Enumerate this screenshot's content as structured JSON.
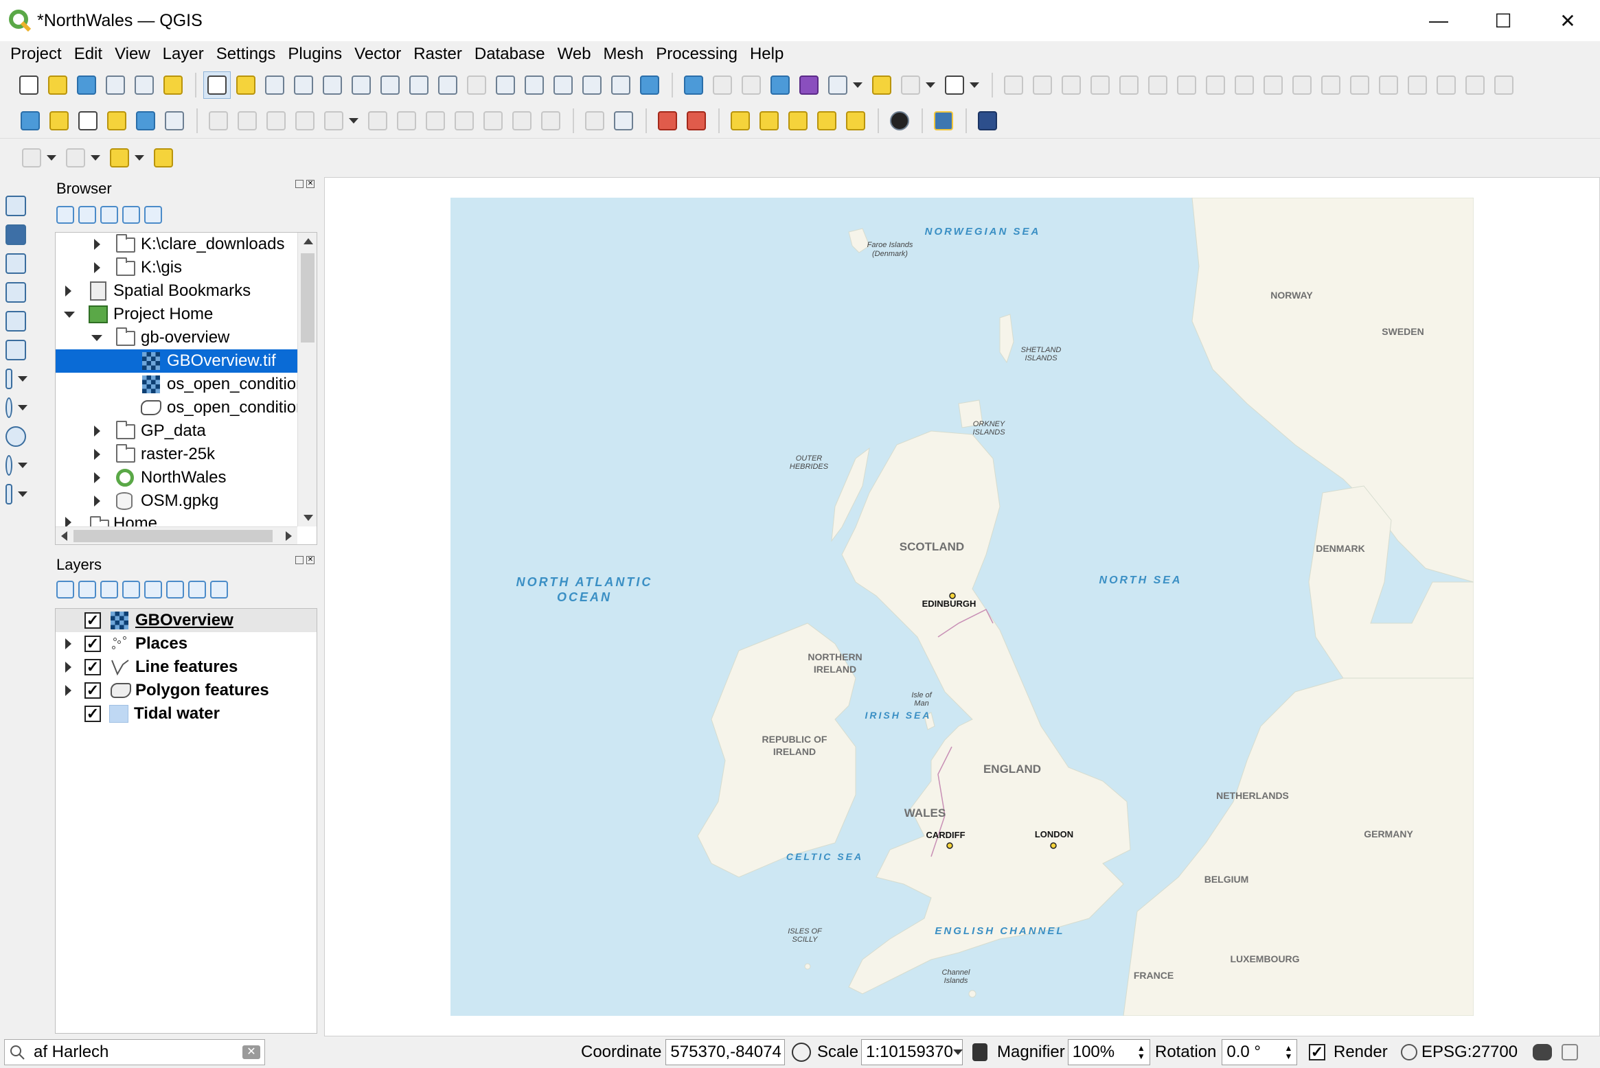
{
  "window": {
    "title": "*NorthWales — QGIS",
    "buttons": {
      "minimize": "—",
      "maximize": "☐",
      "close": "✕"
    }
  },
  "menu": [
    "Project",
    "Edit",
    "View",
    "Layer",
    "Settings",
    "Plugins",
    "Vector",
    "Raster",
    "Database",
    "Web",
    "Mesh",
    "Processing",
    "Help"
  ],
  "browser": {
    "title": "Browser",
    "items": [
      {
        "label": "K:\\clare_downloads",
        "icon": "folder-icon",
        "level": 1,
        "expander": "collapsed"
      },
      {
        "label": "K:\\gis",
        "icon": "folder-icon",
        "level": 1,
        "expander": "collapsed"
      },
      {
        "label": "Spatial Bookmarks",
        "icon": "bookmark-icon",
        "level": 0,
        "expander": "collapsed"
      },
      {
        "label": "Project Home",
        "icon": "project-home-icon",
        "level": 0,
        "expander": "expanded"
      },
      {
        "label": "gb-overview",
        "icon": "folder-icon",
        "level": 1,
        "expander": "expanded"
      },
      {
        "label": "GBOverview.tif",
        "icon": "raster-icon",
        "level": 2,
        "expander": "none",
        "selected": true
      },
      {
        "label": "os_open_condition",
        "icon": "raster-icon",
        "level": 2,
        "expander": "none"
      },
      {
        "label": "os_open_condition",
        "icon": "polygon-icon",
        "level": 2,
        "expander": "none"
      },
      {
        "label": "GP_data",
        "icon": "folder-icon",
        "level": 1,
        "expander": "collapsed"
      },
      {
        "label": "raster-25k",
        "icon": "folder-icon",
        "level": 1,
        "expander": "collapsed"
      },
      {
        "label": "NorthWales",
        "icon": "qgis-project-icon",
        "level": 1,
        "expander": "collapsed"
      },
      {
        "label": "OSM.gpkg",
        "icon": "geopackage-icon",
        "level": 1,
        "expander": "collapsed"
      },
      {
        "label": "Home",
        "icon": "folder-icon",
        "level": 0,
        "expander": "collapsed"
      }
    ]
  },
  "layers": {
    "title": "Layers",
    "items": [
      {
        "label": "GBOverview",
        "icon": "raster-icon",
        "checked": true,
        "expander": "none",
        "underline": true
      },
      {
        "label": "Places",
        "icon": "point-layer-icon",
        "checked": true,
        "expander": "collapsed"
      },
      {
        "label": "Line features",
        "icon": "line-layer-icon",
        "checked": true,
        "expander": "collapsed"
      },
      {
        "label": "Polygon features",
        "icon": "polygon-layer-icon",
        "checked": true,
        "expander": "collapsed"
      },
      {
        "label": "Tidal water",
        "icon": "tidal-water-icon",
        "checked": true,
        "expander": "none"
      }
    ]
  },
  "map": {
    "labels": {
      "norwegian_sea": "NORWEGIAN SEA",
      "faroe": "Faroe Islands",
      "faroe2": "(Denmark)",
      "norway": "NORWAY",
      "sweden": "SWEDEN",
      "shetland": "SHETLAND",
      "shetland2": "ISLANDS",
      "orkney": "ORKNEY",
      "orkney2": "ISLANDS",
      "outer": "OUTER",
      "outer2": "HEBRIDES",
      "scotland": "SCOTLAND",
      "nao1": "NORTH ATLANTIC",
      "nao2": "OCEAN",
      "north_sea": "NORTH SEA",
      "denmark": "DENMARK",
      "edinburgh": "EDINBURGH",
      "ni1": "NORTHERN",
      "ni2": "IRELAND",
      "iom1": "Isle of",
      "iom2": "Man",
      "irish_sea": "IRISH SEA",
      "roi1": "REPUBLIC OF",
      "roi2": "IRELAND",
      "england": "ENGLAND",
      "netherlands": "NETHERLANDS",
      "wales": "WALES",
      "cardiff": "CARDIFF",
      "london": "LONDON",
      "germany": "GERMANY",
      "celtic_sea": "CELTIC SEA",
      "belgium": "BELGIUM",
      "scilly1": "ISLES OF",
      "scilly2": "SCILLY",
      "channel": "ENGLISH CHANNEL",
      "luxembourg": "LUXEMBOURG",
      "ci1": "Channel",
      "ci2": "Islands",
      "france": "FRANCE"
    },
    "colors": {
      "sea": "#cde7f3",
      "land": "#f6f4ea",
      "sea_label": "#3a8fc4",
      "land_label": "#6f6f6f"
    }
  },
  "status": {
    "locator_value": "af Harlech",
    "coordinate_label": "Coordinate",
    "coordinate_value": "575370,-84074",
    "scale_label": "Scale",
    "scale_value": "1:10159370",
    "magnifier_label": "Magnifier",
    "magnifier_value": "100%",
    "rotation_label": "Rotation",
    "rotation_value": "0.0 °",
    "render_label": "Render",
    "crs": "EPSG:27700"
  }
}
